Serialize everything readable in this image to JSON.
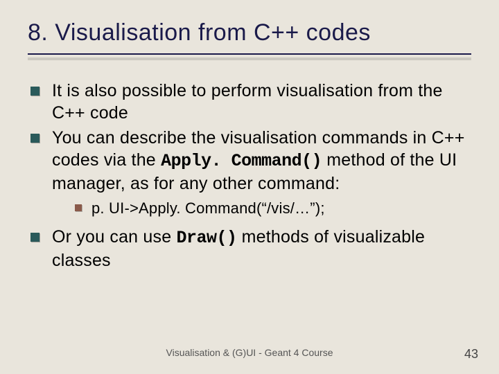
{
  "title": "8. Visualisation from C++ codes",
  "bullets": {
    "b1": "It is also possible to perform visualisation from the C++ code",
    "b2a": "You can describe the visualisation commands in C++ codes via the ",
    "b2_code": "Apply. Command()",
    "b2b": " method of the UI manager, as for any other command:",
    "sub_code": "p. UI->Apply. Command(“/vis/…”);",
    "b3a": "Or you can use ",
    "b3_code": "Draw()",
    "b3b": " methods of visualizable classes"
  },
  "footer": {
    "center": "Visualisation & (G)UI - Geant 4 Course",
    "page": "43"
  }
}
